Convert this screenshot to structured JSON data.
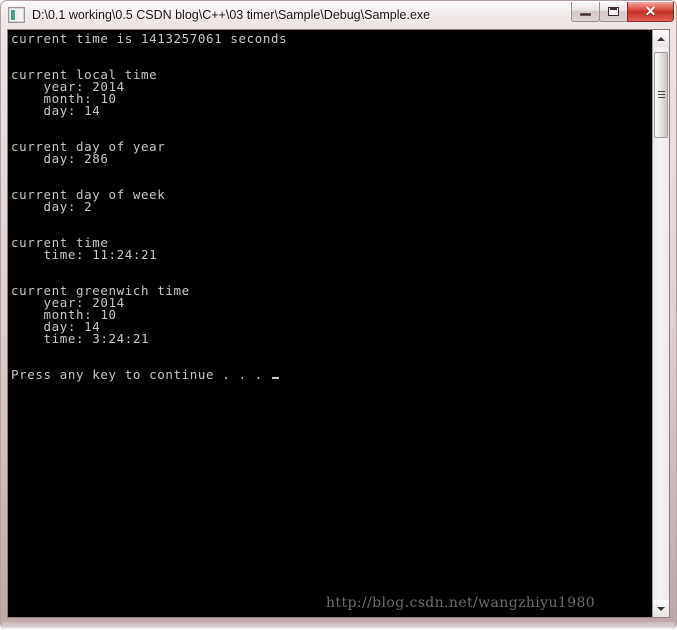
{
  "window": {
    "title": "D:\\0.1 working\\0.5 CSDN blog\\C++\\03 timer\\Sample\\Debug\\Sample.exe",
    "icon_name": "console-app-icon",
    "controls": {
      "minimize_label": "–",
      "maximize_label": "❐",
      "close_label": "✕"
    }
  },
  "console": {
    "output": "current time is 1413257061 seconds\n\n\ncurrent local time\n    year: 2014\n    month: 10\n    day: 14\n\n\ncurrent day of year\n    day: 286\n\n\ncurrent day of week\n    day: 2\n\n\ncurrent time\n    time: 11:24:21\n\n\ncurrent greenwich time\n    year: 2014\n    month: 10\n    day: 14\n    time: 3:24:21\n\n\nPress any key to continue . . .",
    "lines": [
      "current time is 1413257061 seconds",
      "",
      "",
      "current local time",
      "    year: 2014",
      "    month: 10",
      "    day: 14",
      "",
      "",
      "current day of year",
      "    day: 286",
      "",
      "",
      "current day of week",
      "    day: 2",
      "",
      "",
      "current time",
      "    time: 11:24:21",
      "",
      "",
      "current greenwich time",
      "    year: 2014",
      "    month: 10",
      "    day: 14",
      "    time: 3:24:21",
      "",
      "",
      "Press any key to continue . . ."
    ],
    "values": {
      "epoch_seconds": "1413257061",
      "local_year": "2014",
      "local_month": "10",
      "local_day": "14",
      "day_of_year": "286",
      "day_of_week": "2",
      "local_time": "11:24:21",
      "gmt_year": "2014",
      "gmt_month": "10",
      "gmt_day": "14",
      "gmt_time": "3:24:21"
    },
    "background_color": "#000000",
    "text_color": "#c6c6c6"
  },
  "watermark": {
    "text": "http://blog.csdn.net/wangzhiyu1980"
  },
  "scrollbar": {
    "up_arrow": "▲",
    "down_arrow": "▼"
  },
  "colors": {
    "frame": "#cdbcbc",
    "close_button": "#c32f20",
    "console_bg": "#000000",
    "console_fg": "#c6c6c6"
  }
}
